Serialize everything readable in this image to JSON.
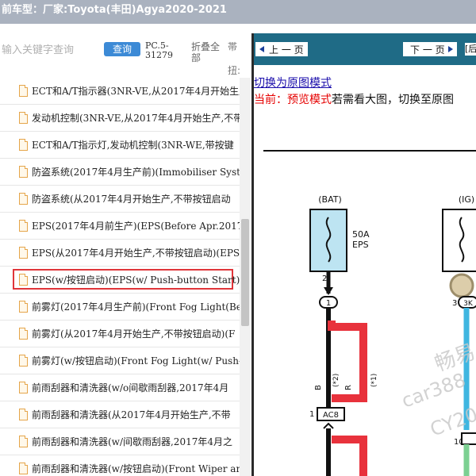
{
  "window": {
    "title": "前车型：厂家:Toyota(丰田)Agya2020-2021"
  },
  "search": {
    "placeholder": "输入关键字查询",
    "query_label": "查询",
    "part_code": "PC.5-31279",
    "collapse_label": "折叠全部",
    "edge_top": "帯",
    "edge_bottom": "扭:"
  },
  "list": {
    "items": [
      "ECT和A/T指示器(3NR-VE,从2017年4月开始生产",
      "发动机控制(3NR-VE,从2017年4月开始生产,不带",
      "ECT和A/T指示灯,发动机控制(3NR-WE,带按键",
      "防盗系统(2017年4月生产前)(Immobiliser System",
      "防盗系统(从2017年4月开始生产,不带按钮启动",
      "EPS(2017年4月前生产)(EPS(Before Apr.2017 Pr",
      "EPS(从2017年4月开始生产,不带按钮启动)(EPS",
      "EPS(w/按钮启动)(EPS(w/ Push-button Start))",
      "前雾灯(2017年4月生产前)(Front Fog Light(Bef",
      "前雾灯(从2017年4月开始生产,不带按钮启动)(F",
      "前雾灯(w/按钮启动)(Front Fog Light(w/ Push-b",
      "前雨刮器和清洗器(w/o间歇雨刮器,2017年4月",
      "前雨刮器和清洗器(从2017年4月开始生产,不带",
      "前雨刮器和清洗器(w/间歇雨刮器,2017年4月之",
      "前雨刮器和清洗器(w/按钮启动)(Front Wiper an"
    ],
    "selected_index": 7
  },
  "viewer": {
    "prev_label": "上 一 页",
    "next_label": "下 一 页",
    "extra_label": "[后",
    "switch_link": "切换为原图模式",
    "mode_prefix": "当前：预览模式",
    "mode_suffix": "若需看大图，切换至原图"
  },
  "diagram": {
    "bat_label": "(BAT)",
    "ig_label": "(IG)",
    "fuse_rating": "50A",
    "fuse_name": "EPS",
    "pin_left": "2",
    "pin_right": "3",
    "connector_left": "1",
    "connector_right": "3K",
    "wire_b": "B",
    "wire_r": "R",
    "note_a": "(*2)",
    "note_b": "(*1)",
    "ac8_pin": "1",
    "ac8_label": "AC8",
    "bottom_pin": "10",
    "watermark_1": "畅易",
    "watermark_2": "car388",
    "watermark_3": "CY20"
  },
  "colors": {
    "titlebar": "#aab2bf",
    "query_button": "#3c8ad6",
    "viewer_nav": "#1f6b86",
    "selection_border": "#e0353a",
    "mode_text": "#e60000",
    "wire_red": "#e8323c",
    "wire_blue": "#3fb6e0",
    "fuse_fill": "#bde4f2"
  }
}
